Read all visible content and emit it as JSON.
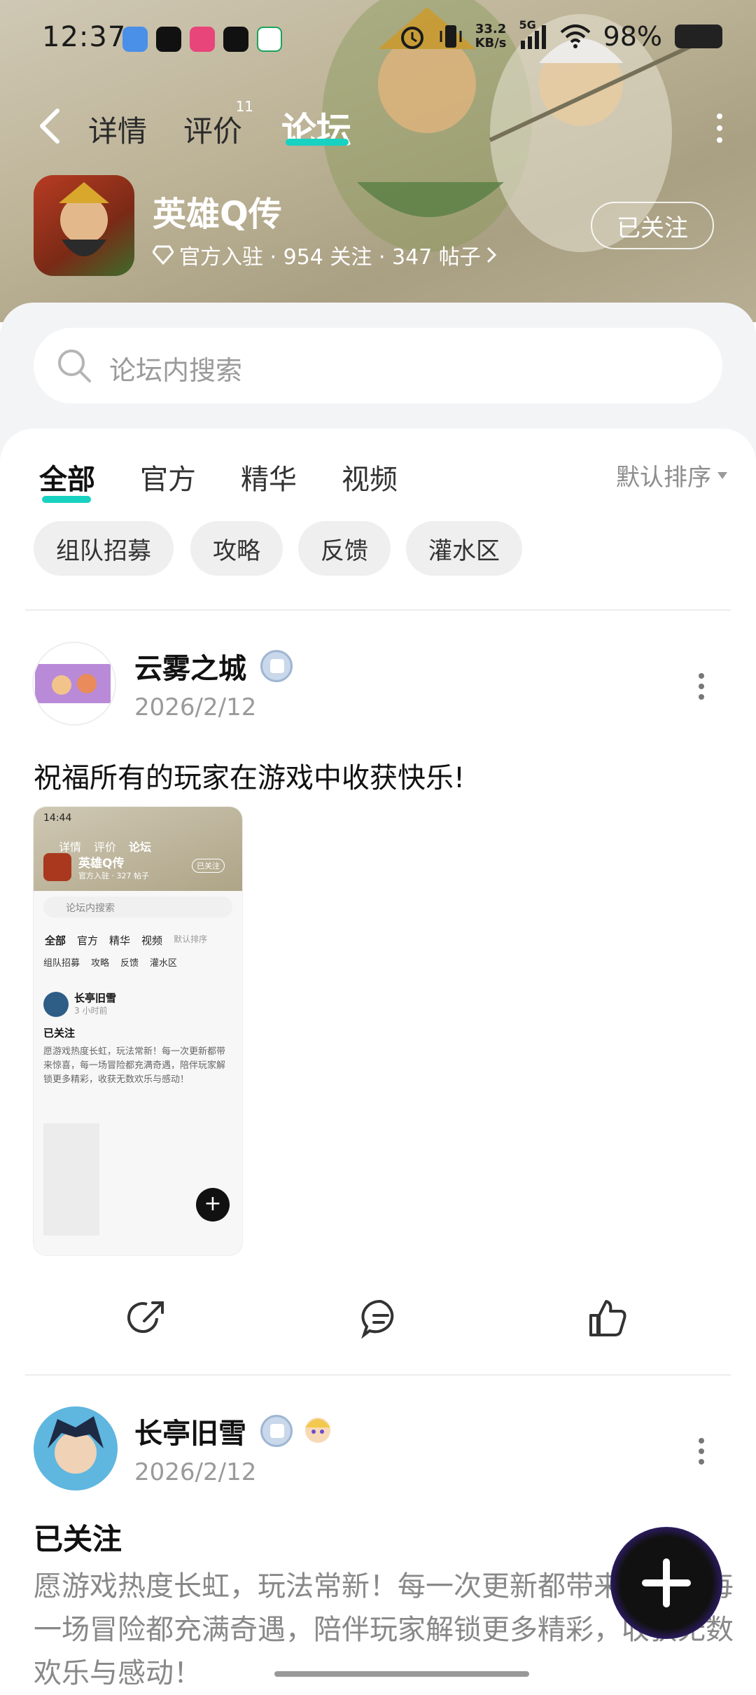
{
  "status_bar": {
    "time": "12:37",
    "net_speed_value": "33.2",
    "net_speed_unit": "KB/s",
    "signal_label": "5G",
    "battery": "98%"
  },
  "nav": {
    "tabs": [
      {
        "label": "详情"
      },
      {
        "label": "评价",
        "badge": "11"
      },
      {
        "label": "论坛"
      }
    ],
    "active_tab": "论坛"
  },
  "app": {
    "name": "英雄Q传",
    "meta": "官方入驻 · 954 关注 · 347 帖子",
    "follow_label": "已关注"
  },
  "search": {
    "placeholder": "论坛内搜索"
  },
  "filters": {
    "tabs": [
      "全部",
      "官方",
      "精华",
      "视频"
    ],
    "active": "全部",
    "sort_label": "默认排序",
    "chips": [
      "组队招募",
      "攻略",
      "反馈",
      "灌水区"
    ]
  },
  "posts": [
    {
      "user": "云雾之城",
      "date": "2026/2/12",
      "text": "祝福所有的玩家在游戏中收获快乐!"
    },
    {
      "user": "长亭旧雪",
      "date": "2026/2/12",
      "title": "已关注",
      "body": "愿游戏热度长虹，玩法常新！每一次更新都带来惊喜，每一场冒险都充满奇遇，陪伴玩家解锁更多精彩，收获无数欢乐与感动！"
    }
  ],
  "screenshot_preview": {
    "time": "14:44",
    "tabs": [
      "详情",
      "评价",
      "论坛"
    ],
    "app_name": "英雄Q传",
    "app_meta": "官方入驻 · 327 帖子",
    "follow_label": "已关注",
    "search_placeholder": "论坛内搜索",
    "filter_tabs": [
      "全部",
      "官方",
      "精华",
      "视频"
    ],
    "sort_label": "默认排序",
    "chips": [
      "组队招募",
      "攻略",
      "反馈",
      "灌水区"
    ],
    "post_user": "长亭旧雪",
    "post_time": "3 小时前",
    "post_title": "已关注",
    "post_body": "愿游戏热度长虹，玩法常新！每一次更新都带来惊喜，每一场冒险都充满奇遇，陪伴玩家解锁更多精彩，收获无数欢乐与感动！"
  },
  "colors": {
    "accent": "#18d2c1",
    "hero_bg": "#bdb397",
    "panel_bg": "#f3f4f6",
    "muted_text": "#9a9a9a"
  }
}
